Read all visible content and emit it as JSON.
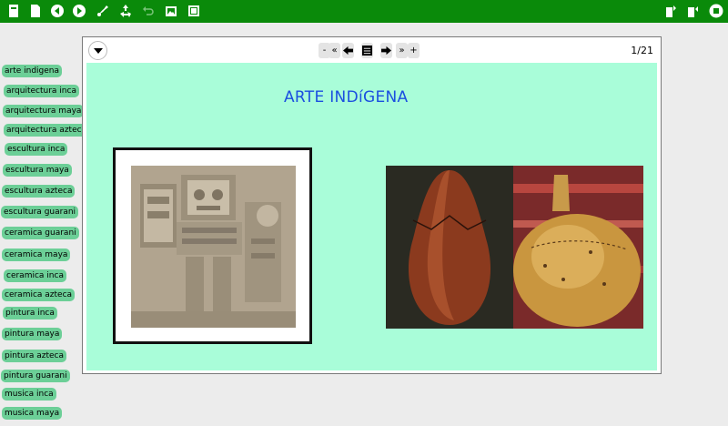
{
  "toolbar": {
    "left_icons": [
      "journal-icon",
      "document-icon",
      "back-icon",
      "forward-icon",
      "paint-icon",
      "recycle-icon",
      "undo-icon",
      "gallery-icon",
      "fullscreen-icon"
    ],
    "right_icons": [
      "save-icon",
      "bookmark-icon",
      "stop-icon"
    ],
    "color": "#0a8a0a"
  },
  "sidebar": {
    "items": [
      {
        "label": "arte indigena"
      },
      {
        "label": "arquitectura inca"
      },
      {
        "label": "arquitectura maya"
      },
      {
        "label": "arquitectura azteca"
      },
      {
        "label": "escultura inca"
      },
      {
        "label": "escultura maya"
      },
      {
        "label": "escultura azteca"
      },
      {
        "label": "escultura guarani"
      },
      {
        "label": "ceramica guarani"
      },
      {
        "label": "ceramica maya"
      },
      {
        "label": "ceramica inca"
      },
      {
        "label": "ceramica azteca"
      },
      {
        "label": "pintura inca"
      },
      {
        "label": "pintura maya"
      },
      {
        "label": "pintura azteca"
      },
      {
        "label": "pintura guarani"
      },
      {
        "label": "musica inca"
      },
      {
        "label": "musica maya"
      }
    ]
  },
  "viewer": {
    "nav": {
      "zoom_out": "-",
      "first": "«",
      "prev_icon": "arrow-left-icon",
      "index_icon": "list-icon",
      "next_icon": "arrow-right-icon",
      "last": "»",
      "zoom_in": "+"
    },
    "page_counter": "1/21",
    "slide": {
      "title": "ARTE INDíGENA",
      "background": "#a9fdd9",
      "title_color": "#1b4fe0"
    }
  }
}
